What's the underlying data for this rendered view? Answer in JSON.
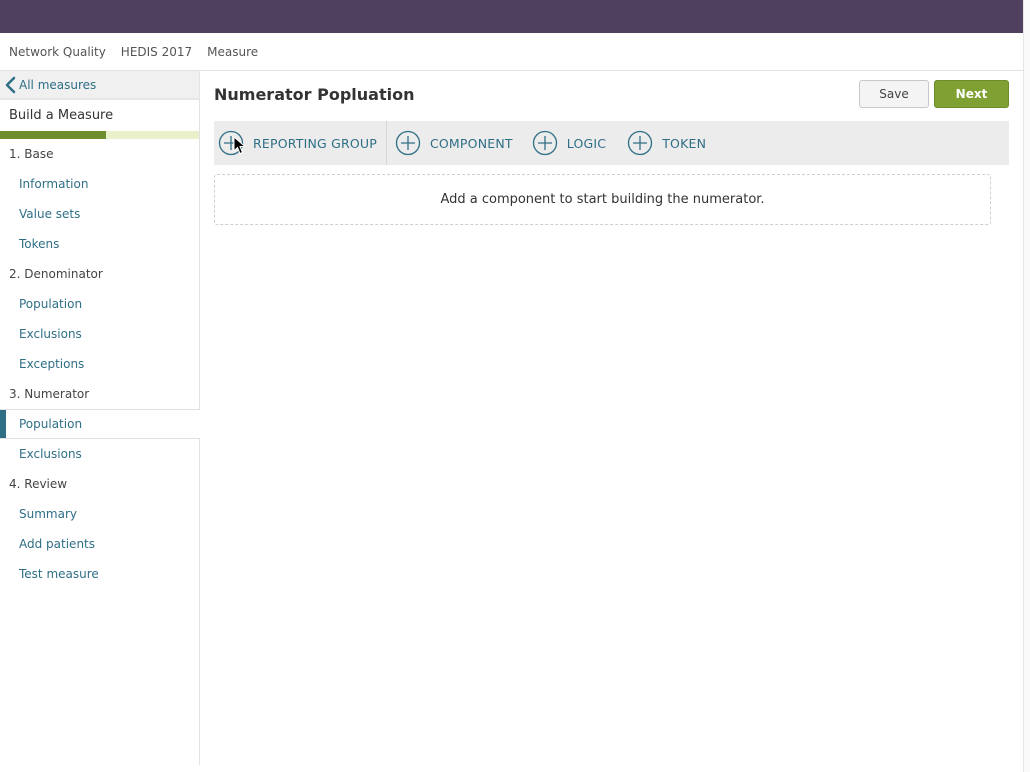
{
  "breadcrumb": [
    "Network Quality",
    "HEDIS 2017",
    "Measure"
  ],
  "sidebar": {
    "back_label": "All measures",
    "build_title": "Build a Measure",
    "progress": 0.535,
    "items": [
      {
        "label": "1. Base",
        "type": "section"
      },
      {
        "label": "Information",
        "type": "sub"
      },
      {
        "label": "Value sets",
        "type": "sub"
      },
      {
        "label": "Tokens",
        "type": "sub"
      },
      {
        "label": "2. Denominator",
        "type": "section"
      },
      {
        "label": "Population",
        "type": "sub"
      },
      {
        "label": "Exclusions",
        "type": "sub"
      },
      {
        "label": "Exceptions",
        "type": "sub"
      },
      {
        "label": "3. Numerator",
        "type": "section"
      },
      {
        "label": "Population",
        "type": "sub",
        "active": true
      },
      {
        "label": "Exclusions",
        "type": "sub"
      },
      {
        "label": "4. Review",
        "type": "section"
      },
      {
        "label": "Summary",
        "type": "sub"
      },
      {
        "label": "Add patients",
        "type": "sub"
      },
      {
        "label": "Test measure",
        "type": "sub"
      }
    ]
  },
  "main": {
    "title": "Numerator Popluation",
    "save_label": "Save",
    "next_label": "Next",
    "toolbar": [
      "REPORTING GROUP",
      "COMPONENT",
      "LOGIC",
      "TOKEN"
    ],
    "empty_message": "Add a component to start building the numerator."
  },
  "colors": {
    "topbar": "#4f4060",
    "accent": "#2f6f86",
    "next_button": "#7fa133",
    "progress_fill": "#6f8f2f",
    "progress_track": "#eaf0c9"
  }
}
